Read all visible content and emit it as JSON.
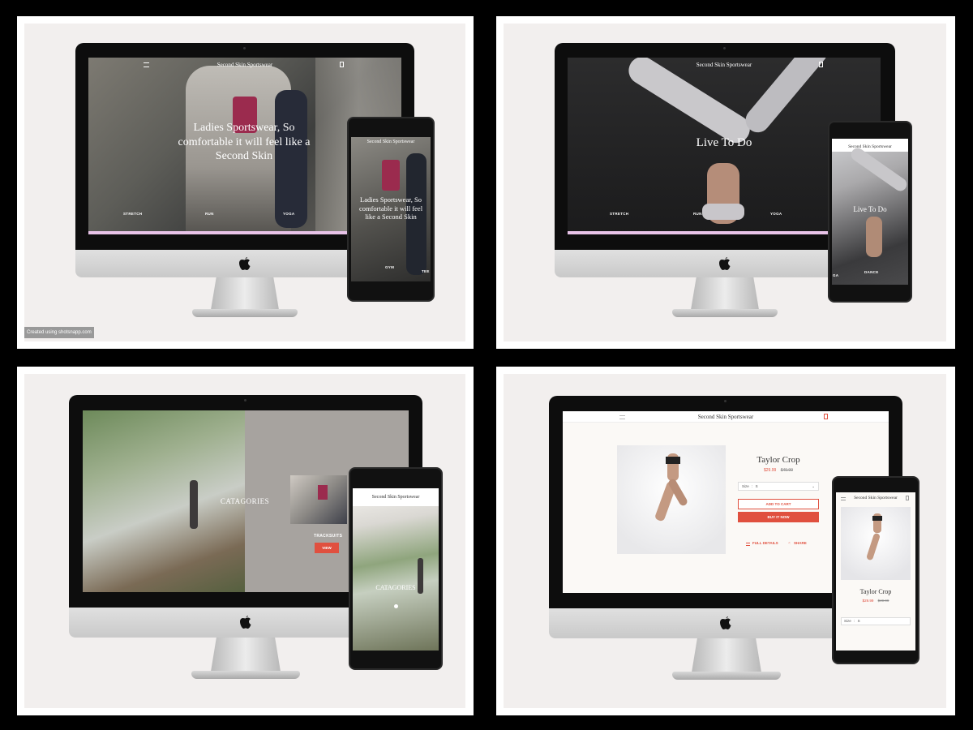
{
  "brand": {
    "name": "Second Skin Sportswear"
  },
  "watermark": "Created using shotsnapp.com",
  "mockup1": {
    "hero": "Ladies Sportswear, So comfortable it will feel like a Second Skin",
    "nav": [
      "STRETCH",
      "RUN",
      "YOGA"
    ],
    "phone_nav": [
      "GYM",
      "TEE"
    ]
  },
  "mockup2": {
    "hero": "Live To Do",
    "nav": [
      "STRETCH",
      "RUN",
      "YOGA"
    ],
    "phone_nav": [
      "GA",
      "DANCE"
    ]
  },
  "mockup3": {
    "title": "CATAGORIES",
    "category": "TRACKSUITS",
    "button": "VIEW"
  },
  "mockup4": {
    "product": "Taylor Crop",
    "price": "$29.99",
    "old_price": "$49.99",
    "size_label": "Size",
    "size_value": "S",
    "add_to_cart": "ADD TO CART",
    "buy_now": "BUY IT NOW",
    "full_details": "FULL DETAILS",
    "share": "SHARE"
  },
  "colors": {
    "accent": "#e0503f",
    "pink": "#e8c3e8",
    "bg": "#f2efee"
  }
}
